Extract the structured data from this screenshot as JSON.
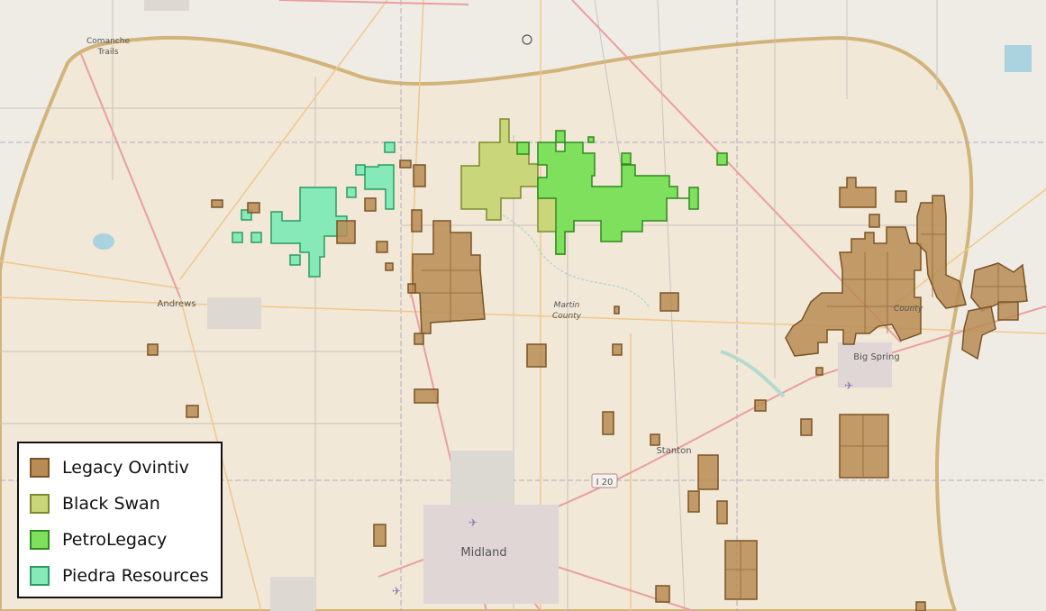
{
  "map": {
    "places": {
      "comanche_trails": [
        "Comanche",
        "Trails"
      ],
      "andrews": "Andrews",
      "martin_county": [
        "Martin",
        "County"
      ],
      "big_spring": "Big Spring",
      "howard_county": "County",
      "stanton": "Stanton",
      "midland": "Midland",
      "i20": "I 20"
    },
    "colors": {
      "legacy_ovintiv": "#b5834a",
      "black_swan": "#c5d46a",
      "petrolegacy": "#6fe04f",
      "piedra_resources": "#7de8b0",
      "basin_outline": "#d2b47a",
      "basin_fill": "#f1e8d8",
      "land": "#efece6"
    }
  },
  "legend": {
    "items": [
      {
        "label": "Legacy Ovintiv",
        "color": "#b98c55",
        "border": "#7a5426"
      },
      {
        "label": "Black Swan",
        "color": "#c9d77a",
        "border": "#7d8a30"
      },
      {
        "label": "PetroLegacy",
        "color": "#7ee05d",
        "border": "#2e8a1c"
      },
      {
        "label": "Piedra Resources",
        "color": "#85eab8",
        "border": "#2d9a64"
      }
    ]
  }
}
